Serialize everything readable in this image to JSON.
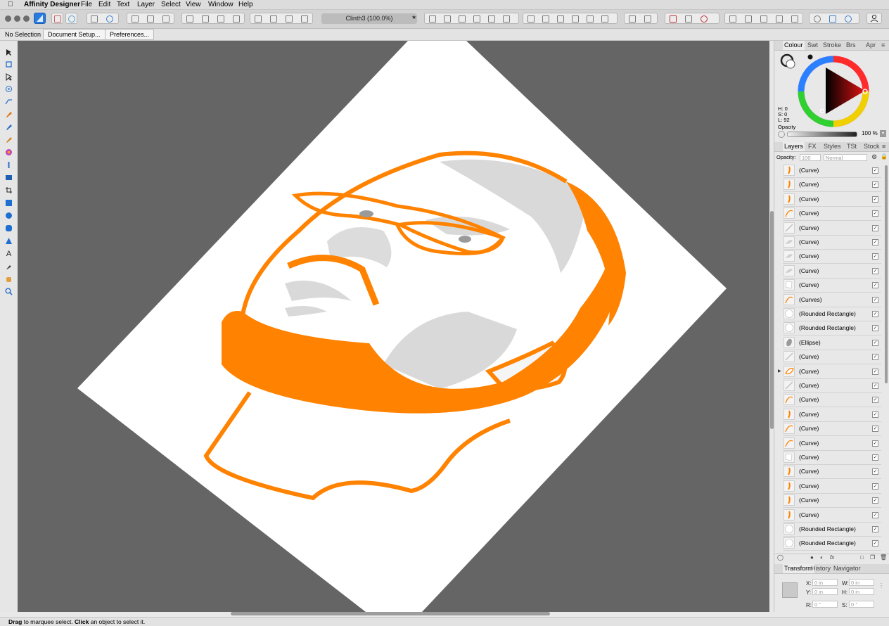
{
  "menubar": {
    "app_name": "Affinity Designer",
    "items": [
      "File",
      "Edit",
      "Text",
      "Layer",
      "Select",
      "View",
      "Window",
      "Help"
    ]
  },
  "toolbar": {
    "document_title": "Clinth3 (100.0%)"
  },
  "context_bar": {
    "selection": "No Selection",
    "document_setup": "Document Setup...",
    "preferences": "Preferences..."
  },
  "colour_panel": {
    "tabs": [
      "Colour",
      "Swt",
      "Stroke",
      "Brs",
      "Apr"
    ],
    "h": "H: 0",
    "s": "S: 0",
    "l": "L: 92",
    "opacity_label": "Opacity",
    "opacity_value": "100 %"
  },
  "layers_panel": {
    "tabs": [
      "Layers",
      "FX",
      "Styles",
      "TSt",
      "Stock"
    ],
    "opacity_label": "Opacity:",
    "opacity_value": "100",
    "blend_mode": "Normal",
    "rows": [
      {
        "name": "(Curve)",
        "thumb": "orange-stroke"
      },
      {
        "name": "(Curve)",
        "thumb": "orange-stroke"
      },
      {
        "name": "(Curve)",
        "thumb": "orange-stroke"
      },
      {
        "name": "(Curve)",
        "thumb": "orange-curve"
      },
      {
        "name": "(Curve)",
        "thumb": "grey-line"
      },
      {
        "name": "(Curve)",
        "thumb": "grey-shape"
      },
      {
        "name": "(Curve)",
        "thumb": "grey-shape"
      },
      {
        "name": "(Curve)",
        "thumb": "grey-shape"
      },
      {
        "name": "(Curve)",
        "thumb": "white-shape"
      },
      {
        "name": "(Curves)",
        "thumb": "orange-curve"
      },
      {
        "name": "(Rounded Rectangle)",
        "thumb": "white-circle"
      },
      {
        "name": "(Rounded Rectangle)",
        "thumb": "white-circle"
      },
      {
        "name": "(Ellipse)",
        "thumb": "grey-ellipse"
      },
      {
        "name": "(Curve)",
        "thumb": "grey-line"
      },
      {
        "name": "(Curve)",
        "thumb": "orange-face",
        "expandable": true
      },
      {
        "name": "(Curve)",
        "thumb": "grey-line"
      },
      {
        "name": "(Curve)",
        "thumb": "orange-curve"
      },
      {
        "name": "(Curve)",
        "thumb": "orange-stroke"
      },
      {
        "name": "(Curve)",
        "thumb": "orange-curve"
      },
      {
        "name": "(Curve)",
        "thumb": "orange-curve"
      },
      {
        "name": "(Curve)",
        "thumb": "white-shape"
      },
      {
        "name": "(Curve)",
        "thumb": "orange-stroke"
      },
      {
        "name": "(Curve)",
        "thumb": "orange-stroke"
      },
      {
        "name": "(Curve)",
        "thumb": "orange-stroke"
      },
      {
        "name": "(Curve)",
        "thumb": "orange-stroke"
      },
      {
        "name": "(Rounded Rectangle)",
        "thumb": "white-circle"
      },
      {
        "name": "(Rounded Rectangle)",
        "thumb": "white-circle"
      }
    ]
  },
  "transform_panel": {
    "tabs": [
      "Transform",
      "History",
      "Navigator"
    ],
    "x_label": "X:",
    "x_value": "0 in",
    "y_label": "Y:",
    "y_value": "0 in",
    "w_label": "W:",
    "w_value": "0 in",
    "h_label": "H:",
    "h_value": "0 in",
    "r_label": "R:",
    "r_value": "0 °",
    "s_label": "S:",
    "s_value": "0 °"
  },
  "status": {
    "drag": "Drag",
    "text1": " to marquee select. ",
    "click": "Click",
    "text2": " an object to select it."
  },
  "colors": {
    "accent_orange": "#ff8200",
    "canvas_grey": "#656565",
    "shade_grey": "#d9d9d9"
  }
}
